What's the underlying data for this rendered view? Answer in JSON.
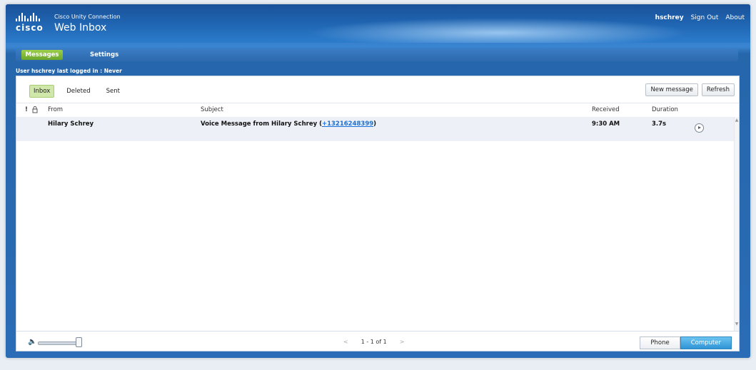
{
  "header": {
    "brand": "cisco",
    "product_line": "Cisco Unity Connection",
    "product_name": "Web Inbox",
    "username": "hschrey",
    "sign_out": "Sign Out",
    "about": "About"
  },
  "tabs": {
    "messages": "Messages",
    "settings": "Settings"
  },
  "last_login": "User hschrey last logged in : Never",
  "folders": [
    "Inbox",
    "Deleted",
    "Sent"
  ],
  "actions": {
    "new_message": "New message",
    "refresh": "Refresh"
  },
  "columns": {
    "priority": "!",
    "lock": "lock-icon",
    "from": "From",
    "subject": "Subject",
    "received": "Received",
    "duration": "Duration"
  },
  "messages": [
    {
      "from": "Hilary Schrey",
      "subject_prefix": "Voice Message from Hilary Schrey (",
      "subject_link": "+13216248399",
      "subject_suffix": ")",
      "received": "9:30 AM",
      "duration": "3.7s"
    }
  ],
  "pager": {
    "text": "1 - 1 of 1",
    "prev": "<",
    "next": ">"
  },
  "playback": {
    "phone": "Phone",
    "computer": "Computer",
    "selected": "Computer"
  },
  "volume": {
    "level": 0.95
  }
}
